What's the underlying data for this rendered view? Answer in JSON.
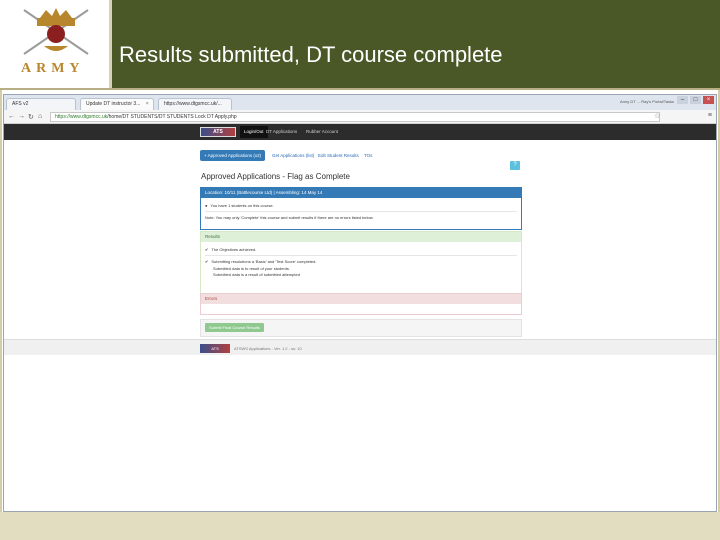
{
  "slide": {
    "title": "Results submitted, DT course complete",
    "logo_text": "ARMY"
  },
  "browser": {
    "tabs": [
      {
        "label": "AFS v2"
      },
      {
        "label": "Update DT instructor 3..."
      },
      {
        "label": "https://www.dtgsmcc.uk/..."
      }
    ],
    "tab_tail_text": "Army DT ... Ray's Portal/Tasks",
    "url_secure": "https://www.dtgsmcc.uk",
    "url_rest": "/home/DT STUDENTS/DT STUDENTS Lock DT Apply.php",
    "back": "←",
    "forward": "→",
    "reload": "↻",
    "home": "⌂",
    "star": "☆",
    "menu": "≡",
    "minimize": "–",
    "maximize": "□",
    "close": "×"
  },
  "app_nav": {
    "brand": "ATS",
    "items": [
      "Login/Out",
      "DT Applications",
      "Rubber Account"
    ]
  },
  "subnav": {
    "items": [
      "+ Approved Applications (x2)",
      "Get Applications (list)",
      "Edit Student Results",
      "TOs"
    ],
    "help": "?"
  },
  "page": {
    "heading": "Approved Applications - Flag as Complete"
  },
  "panels": {
    "course_header": "Location: 10/11 (Battlecourse Ltd) | Assembling: 14 May 14",
    "course_lines": [
      "You have 1 students on this course.",
      "Note: You may only 'Complete' this course and submit results if there are no errors listed below."
    ],
    "results_header": "Results",
    "results_lines": [
      "The Objectives achieved.",
      "Submitting resolutions a 'Basic' and 'Test Score' completed."
    ],
    "results_sub": [
      "Submitted data is to result of your students",
      "Submitted data is a result of submitted attempted"
    ],
    "errors_header": "Errors",
    "submit_label": "Submit Final Course Results"
  },
  "footer": {
    "logo": "ATS",
    "text": "ATSWS Applications - Ver. 1.2 - ss: 10"
  }
}
